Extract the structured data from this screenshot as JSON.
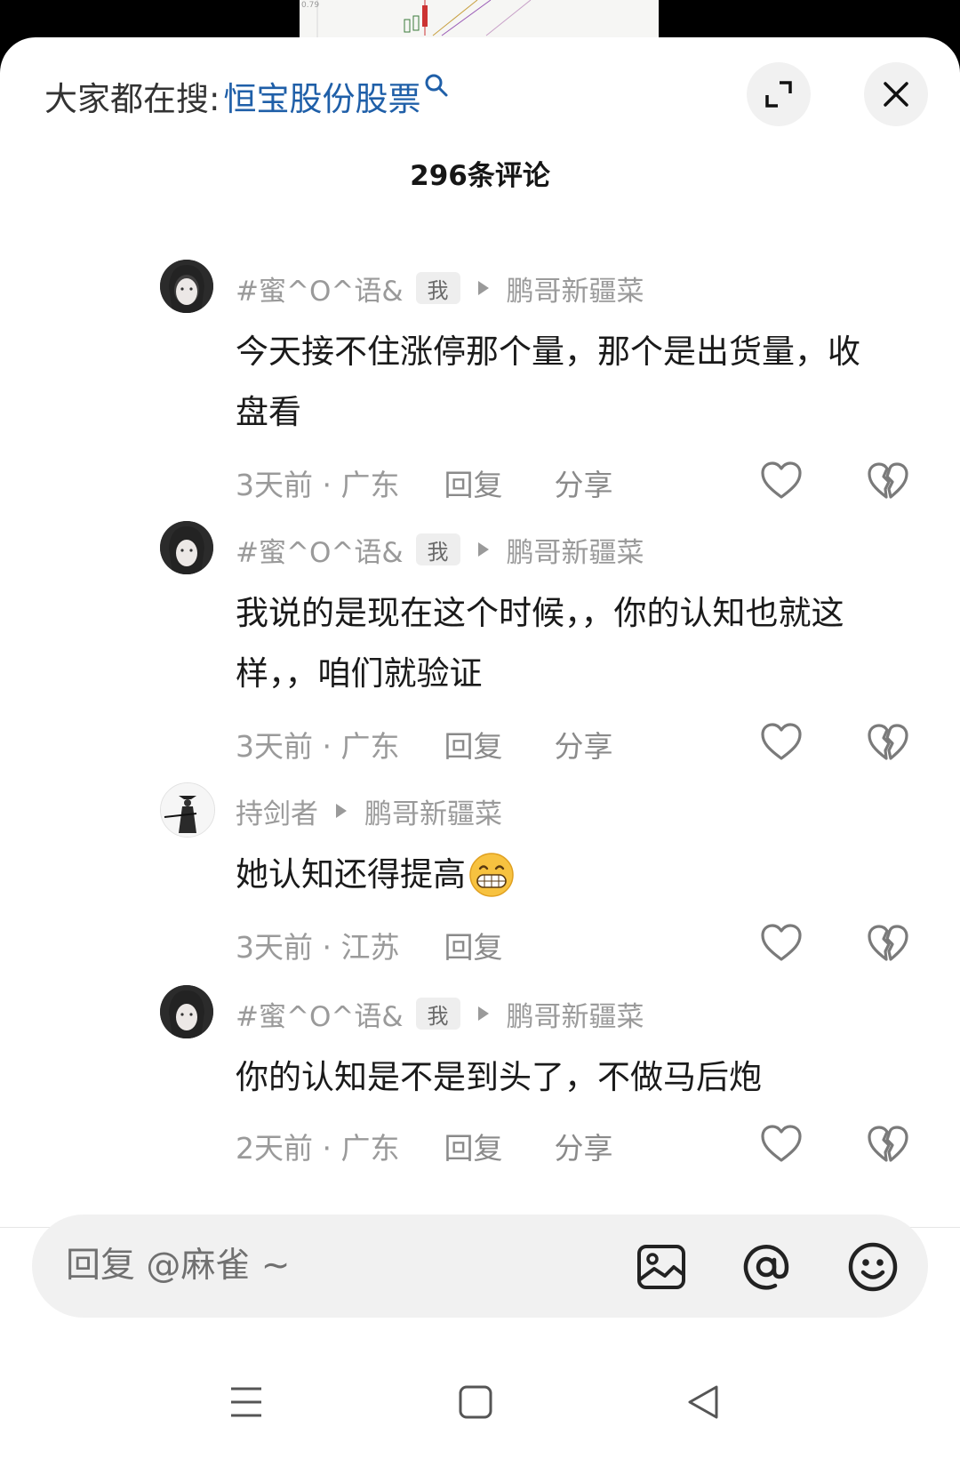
{
  "search": {
    "prefix": "大家都在搜:",
    "term": "恒宝股份股票"
  },
  "comment_count": "296条评论",
  "comments": [
    {
      "author": "#蜜^O^语&",
      "is_me": true,
      "me_badge": "我",
      "reply_to": "鹏哥新疆菜",
      "lines": [
        "今天接不住涨停那个量，那个是出货量，收",
        "盘看"
      ],
      "time_location": "3天前 · 广东",
      "reply_label": "回复",
      "share_label": "分享"
    },
    {
      "author": "#蜜^O^语&",
      "is_me": true,
      "me_badge": "我",
      "reply_to": "鹏哥新疆菜",
      "lines": [
        "我说的是现在这个时候，，你的认知也就这",
        "样，，咱们就验证"
      ],
      "time_location": "3天前 · 广东",
      "reply_label": "回复",
      "share_label": "分享"
    },
    {
      "author": "持剑者",
      "is_me": false,
      "reply_to": "鹏哥新疆菜",
      "lines": [
        "她认知还得提高"
      ],
      "emoji": "grin-emoji",
      "time_location": "3天前 · 江苏",
      "reply_label": "回复"
    },
    {
      "author": "#蜜^O^语&",
      "is_me": true,
      "me_badge": "我",
      "reply_to": "鹏哥新疆菜",
      "lines": [
        "你的认知是不是到头了，不做马后炮"
      ],
      "time_location": "2天前 · 广东",
      "reply_label": "回复",
      "share_label": "分享"
    }
  ],
  "input": {
    "placeholder": "回复 @麻雀 ~"
  },
  "icons": {
    "expand": "expand-icon",
    "close": "close-icon",
    "like": "heart-outline-icon",
    "dislike": "broken-heart-icon",
    "image": "image-icon",
    "mention": "at-icon",
    "emoji": "emoji-icon",
    "nav_menu": "menu-icon",
    "nav_home": "home-square-icon",
    "nav_back": "back-triangle-icon"
  },
  "colors": {
    "search_term": "#1f5fa8",
    "secondary_text": "#9a9a9a",
    "primary_text": "#1a1a1a",
    "input_bg": "#f1f1f1"
  }
}
